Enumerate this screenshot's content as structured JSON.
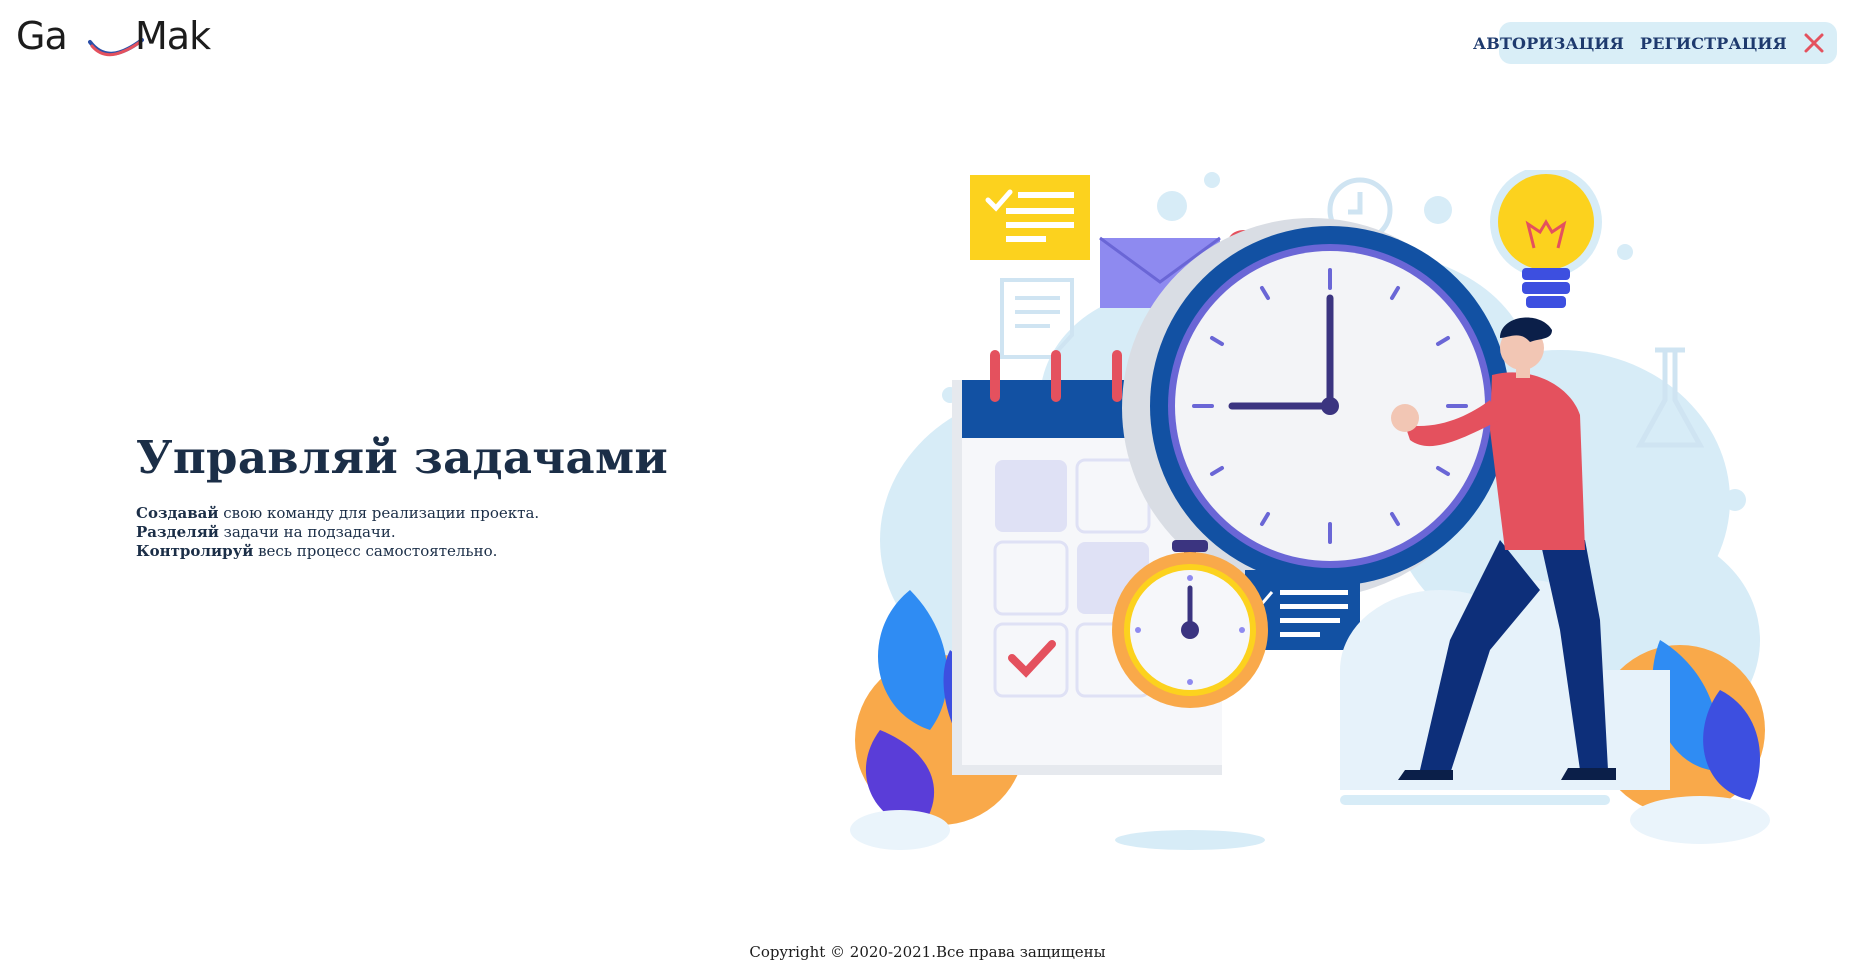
{
  "brand": {
    "logo_left": "Ga",
    "logo_right": "Mak"
  },
  "nav": {
    "login": "АВТОРИЗАЦИЯ",
    "register": "РЕГИСТРАЦИЯ",
    "close_icon": "close-icon"
  },
  "hero": {
    "title": "Управляй задачами",
    "lines": [
      {
        "bold": "Создавай",
        "rest": " свою команду для реализации проекта."
      },
      {
        "bold": "Разделяй",
        "rest": " задачи на подзадачи."
      },
      {
        "bold": "Контролируй",
        "rest": " весь процесс самостоятельно."
      }
    ]
  },
  "footer": {
    "copyright": "Copyright © 2020-2021.Все права защищены"
  },
  "colors": {
    "accent_red": "#e4515e",
    "nav_bg": "#d9eef7",
    "nav_text": "#1e3a6e",
    "title": "#1b2e47",
    "clock_blue": "#1251a3"
  }
}
